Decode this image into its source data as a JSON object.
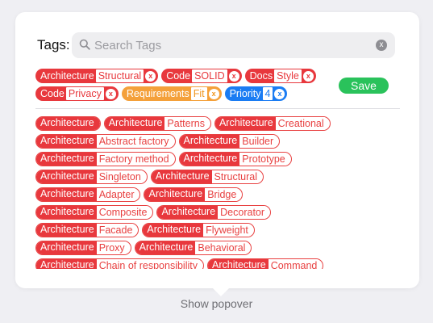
{
  "header": {
    "tags_label": "Tags:"
  },
  "search": {
    "placeholder": "Search Tags",
    "value": ""
  },
  "save_label": "Save",
  "show_popover_label": "Show popover",
  "colors": {
    "red": "#e8383d",
    "orange": "#f4a03a",
    "blue": "#1a7cf3",
    "green": "#2ac25b"
  },
  "selected_tags": [
    [
      {
        "key": "Architecture",
        "value": "Structural",
        "color": "red"
      },
      {
        "key": "Code",
        "value": "SOLID",
        "color": "red"
      },
      {
        "key": "Docs",
        "value": "Style",
        "color": "red"
      }
    ],
    [
      {
        "key": "Code",
        "value": "Privacy",
        "color": "red"
      },
      {
        "key": "Requirements",
        "value": "Fit",
        "color": "orange"
      },
      {
        "key": "Priority",
        "value": "4",
        "color": "blue"
      }
    ]
  ],
  "available_tags": [
    [
      {
        "key": "Architecture",
        "value": ""
      },
      {
        "key": "Architecture",
        "value": "Patterns"
      },
      {
        "key": "Architecture",
        "value": "Creational"
      }
    ],
    [
      {
        "key": "Architecture",
        "value": "Abstract factory"
      },
      {
        "key": "Architecture",
        "value": "Builder"
      }
    ],
    [
      {
        "key": "Architecture",
        "value": "Factory method"
      },
      {
        "key": "Architecture",
        "value": "Prototype"
      }
    ],
    [
      {
        "key": "Architecture",
        "value": "Singleton"
      },
      {
        "key": "Architecture",
        "value": "Structural"
      }
    ],
    [
      {
        "key": "Architecture",
        "value": "Adapter"
      },
      {
        "key": "Architecture",
        "value": "Bridge"
      }
    ],
    [
      {
        "key": "Architecture",
        "value": "Composite"
      },
      {
        "key": "Architecture",
        "value": "Decorator"
      }
    ],
    [
      {
        "key": "Architecture",
        "value": "Facade"
      },
      {
        "key": "Architecture",
        "value": "Flyweight"
      }
    ],
    [
      {
        "key": "Architecture",
        "value": "Proxy"
      },
      {
        "key": "Architecture",
        "value": "Behavioral"
      }
    ],
    [
      {
        "key": "Architecture",
        "value": "Chain of responsibility"
      },
      {
        "key": "Architecture",
        "value": "Command"
      }
    ]
  ]
}
